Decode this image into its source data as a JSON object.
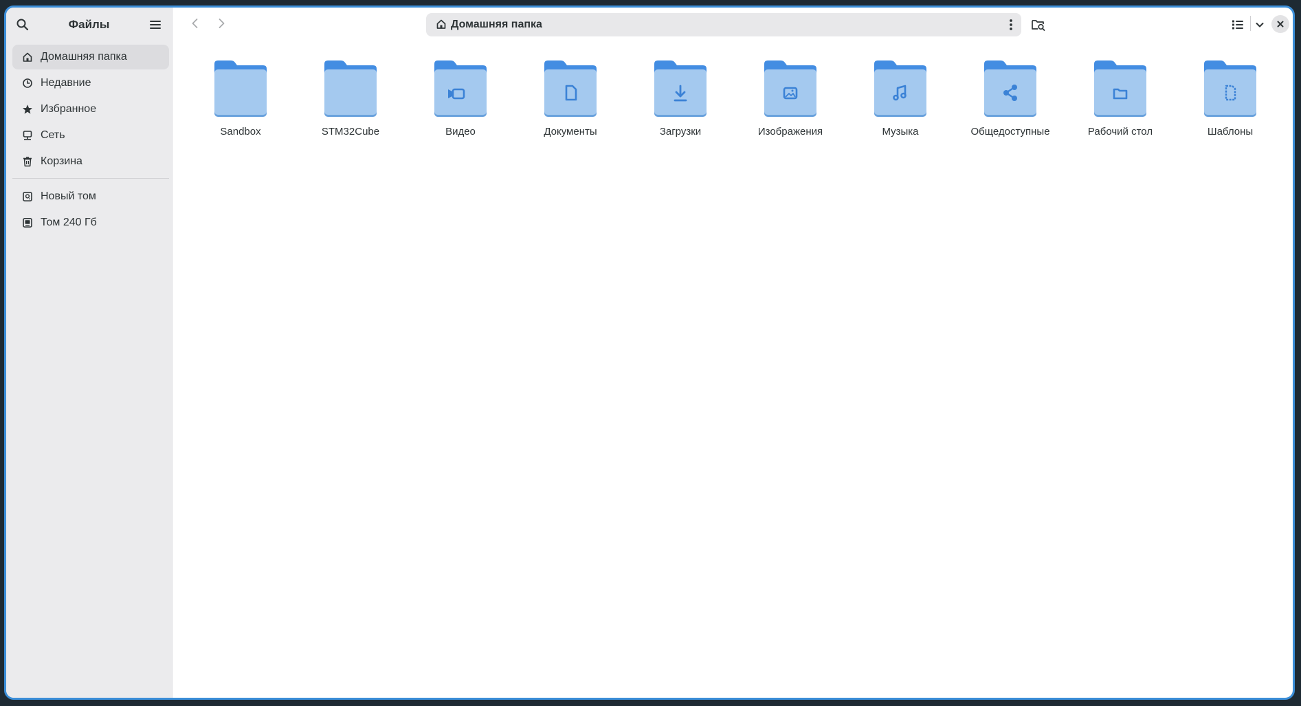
{
  "app": {
    "title": "Файлы"
  },
  "sidebar": {
    "places": [
      {
        "label": "Домашняя папка",
        "icon": "home-icon",
        "active": true
      },
      {
        "label": "Недавние",
        "icon": "clock-icon",
        "active": false
      },
      {
        "label": "Избранное",
        "icon": "star-icon",
        "active": false
      },
      {
        "label": "Сеть",
        "icon": "network-icon",
        "active": false
      },
      {
        "label": "Корзина",
        "icon": "trash-icon",
        "active": false
      }
    ],
    "devices": [
      {
        "label": "Новый том",
        "icon": "drive-icon"
      },
      {
        "label": "Том 240 Гб",
        "icon": "drive-icon"
      }
    ]
  },
  "pathbar": {
    "location": "Домашняя папка"
  },
  "colors": {
    "accent": "#3b8ed8",
    "folder_back": "#438de2",
    "folder_front": "#a4c9ef",
    "folder_emblem": "#3b82d6"
  },
  "files": [
    {
      "name": "Sandbox",
      "emblem": "none"
    },
    {
      "name": "STM32Cube",
      "emblem": "none"
    },
    {
      "name": "Видео",
      "emblem": "camera-icon"
    },
    {
      "name": "Документы",
      "emblem": "document-icon"
    },
    {
      "name": "Загрузки",
      "emblem": "download-icon"
    },
    {
      "name": "Изображения",
      "emblem": "image-icon"
    },
    {
      "name": "Музыка",
      "emblem": "music-icon"
    },
    {
      "name": "Общедоступные",
      "emblem": "share-icon"
    },
    {
      "name": "Рабочий стол",
      "emblem": "folder-icon"
    },
    {
      "name": "Шаблоны",
      "emblem": "template-icon"
    }
  ]
}
